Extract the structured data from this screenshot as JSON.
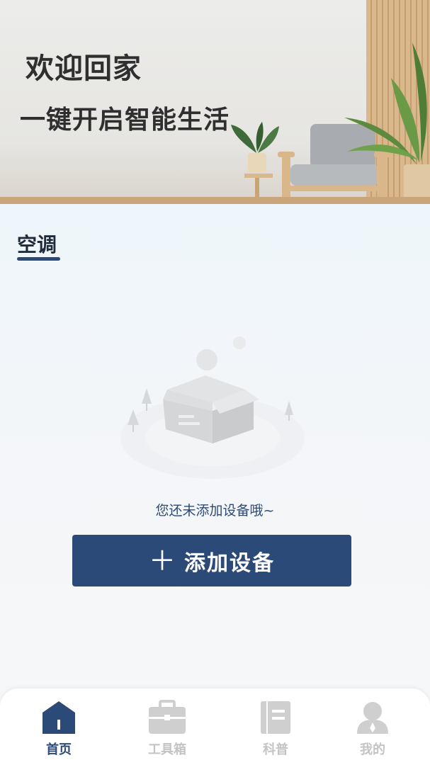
{
  "banner": {
    "title": "欢迎回家",
    "slogan": "一键开启智能生活"
  },
  "tabs": [
    {
      "label": "空调",
      "active": true
    }
  ],
  "empty_state": {
    "message": "您还未添加设备哦~",
    "add_button_label": "添加设备",
    "add_button_icon": "plus-icon"
  },
  "nav": {
    "items": [
      {
        "label": "首页",
        "icon": "home-icon",
        "active": true
      },
      {
        "label": "工具箱",
        "icon": "toolbox-icon",
        "active": false
      },
      {
        "label": "科普",
        "icon": "book-icon",
        "active": false
      },
      {
        "label": "我的",
        "icon": "user-icon",
        "active": false
      }
    ]
  },
  "colors": {
    "accent": "#2c4a78",
    "inactive": "#c4c4c4",
    "text_dark": "#2f2f2f"
  }
}
